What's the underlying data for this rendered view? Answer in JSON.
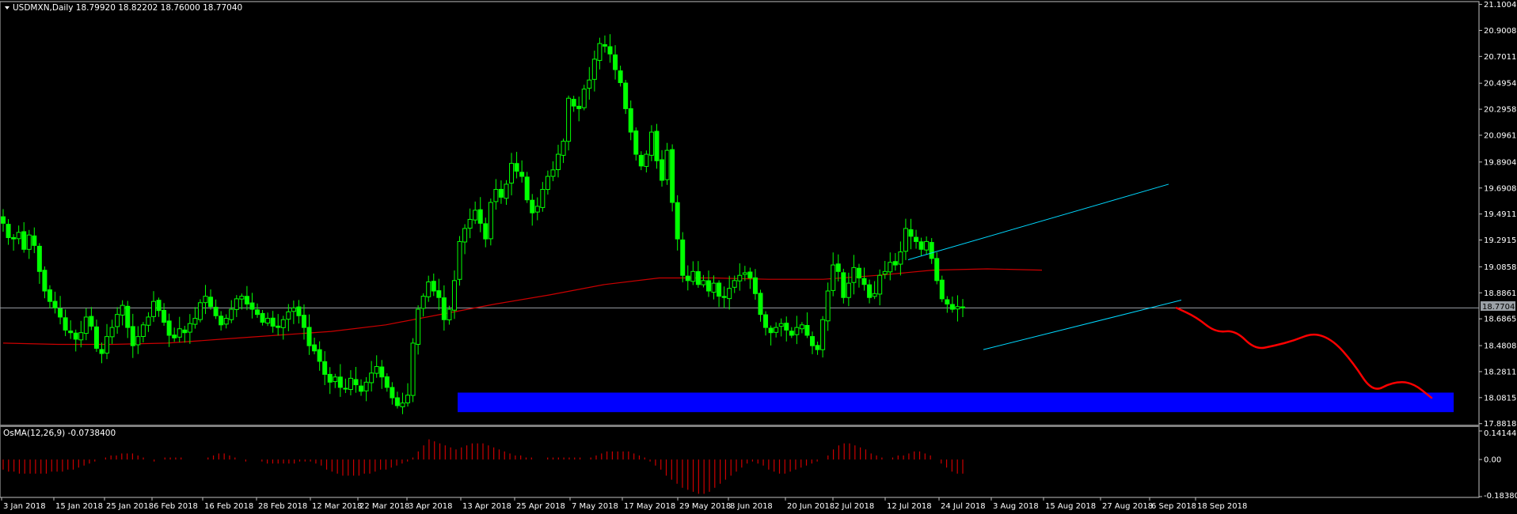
{
  "header": {
    "title": "USDMXN,Daily  18.79920 18.82202 18.76000 18.77040",
    "osma_title": "OsMA(12,26,9) -0.0738400"
  },
  "colors": {
    "background": "#000000",
    "frame": "#c0c0c0",
    "candle": "#00ff00",
    "ma": "#cc0000",
    "channel": "#00d8ff",
    "forecast": "#ff0000",
    "zone": "#0000ff",
    "osma": "#cc0000",
    "current_price_line": "#9aa0a6"
  },
  "chart_data": [
    {
      "type": "candlestick",
      "title": "USDMXN,Daily",
      "ohlc_current": {
        "open": 18.7992,
        "high": 18.82202,
        "low": 18.76,
        "close": 18.7704
      },
      "x_ticks": [
        "3 Jan 2018",
        "15 Jan 2018",
        "25 Jan 2018",
        "6 Feb 2018",
        "16 Feb 2018",
        "28 Feb 2018",
        "12 Mar 2018",
        "22 Mar 2018",
        "3 Apr 2018",
        "13 Apr 2018",
        "25 Apr 2018",
        "7 May 2018",
        "17 May 2018",
        "29 May 2018",
        "8 Jun 2018",
        "20 Jun 2018",
        "2 Jul 2018",
        "12 Jul 2018",
        "24 Jul 2018",
        "3 Aug 2018",
        "15 Aug 2018",
        "27 Aug 2018",
        "6 Sep 2018",
        "18 Sep 2018"
      ],
      "y_ticks": [
        "21.10045",
        "20.90080",
        "20.70115",
        "20.49545",
        "20.29580",
        "20.09615",
        "19.89045",
        "19.69080",
        "19.49115",
        "19.29150",
        "19.08580",
        "18.88615",
        "18.68650",
        "18.48080",
        "18.28115",
        "18.08150",
        "17.88185"
      ],
      "ylim": [
        17.88,
        21.11
      ],
      "current_price": "18.77040",
      "closes": [
        19.42,
        19.31,
        19.3,
        19.35,
        19.22,
        19.33,
        19.25,
        19.05,
        18.9,
        18.82,
        18.77,
        18.7,
        18.6,
        18.58,
        18.53,
        18.58,
        18.7,
        18.63,
        18.46,
        18.42,
        18.55,
        18.62,
        18.72,
        18.79,
        18.62,
        18.48,
        18.55,
        18.64,
        18.7,
        18.82,
        18.75,
        18.66,
        18.56,
        18.54,
        18.61,
        18.58,
        18.65,
        18.69,
        18.81,
        18.86,
        18.78,
        18.71,
        18.64,
        18.69,
        18.76,
        18.84,
        18.86,
        18.8,
        18.76,
        18.72,
        18.66,
        18.69,
        18.63,
        18.62,
        18.68,
        18.74,
        18.77,
        18.71,
        18.62,
        18.48,
        18.44,
        18.36,
        18.26,
        18.2,
        18.24,
        18.16,
        18.15,
        18.23,
        18.18,
        18.13,
        18.2,
        18.27,
        18.32,
        18.24,
        18.16,
        18.08,
        18.02,
        18.04,
        18.1,
        18.5,
        18.76,
        18.86,
        18.97,
        18.9,
        18.85,
        18.68,
        18.76,
        18.98,
        19.28,
        19.38,
        19.45,
        19.52,
        19.42,
        19.3,
        19.58,
        19.68,
        19.62,
        19.72,
        19.88,
        19.82,
        19.78,
        19.6,
        19.5,
        19.55,
        19.68,
        19.78,
        19.83,
        19.95,
        20.05,
        20.38,
        20.32,
        20.3,
        20.45,
        20.52,
        20.68,
        20.8,
        20.78,
        20.72,
        20.6,
        20.5,
        20.3,
        20.12,
        19.95,
        19.86,
        19.95,
        20.12,
        19.9,
        19.75,
        19.98,
        19.58,
        19.3,
        19.02,
        18.98,
        19.05,
        18.95,
        18.98,
        18.9,
        18.96,
        18.86,
        18.85,
        18.92,
        18.98,
        19.02,
        19.04,
        19.0,
        18.88,
        18.72,
        18.62,
        18.58,
        18.62,
        18.65,
        18.6,
        18.56,
        18.62,
        18.64,
        18.56,
        18.48,
        18.45,
        18.68,
        18.9,
        19.1,
        19.05,
        18.85,
        18.96,
        19.08,
        19.0,
        18.95,
        18.85,
        18.88,
        19.02,
        19.05,
        19.12,
        19.1,
        19.2,
        19.38,
        19.32,
        19.28,
        19.22,
        19.28,
        19.15,
        18.98,
        18.84,
        18.8,
        18.76,
        18.78,
        18.77
      ],
      "series": [
        {
          "name": "MA",
          "values": [
            18.5,
            18.49,
            18.49,
            18.5,
            18.53,
            18.56,
            18.59,
            18.64,
            18.72,
            18.8,
            18.87,
            18.95,
            19.0,
            19.0,
            18.99,
            18.99,
            19.02,
            19.06,
            19.07,
            19.06
          ]
        }
      ],
      "forecast": [
        18.77,
        18.7,
        18.58,
        18.6,
        18.45,
        18.48,
        18.52,
        18.58,
        18.52,
        18.35,
        18.12,
        18.2,
        18.2,
        18.08
      ],
      "channel": {
        "upper": {
          "from": [
            "12 Jul 2018",
            19.14
          ],
          "to": [
            "18 Sep 2018",
            19.72
          ]
        },
        "lower": {
          "from": [
            "3 Aug 2018",
            18.45
          ],
          "to": [
            "18 Sep 2018",
            18.83
          ]
        }
      },
      "zone": {
        "from": "13 Apr 2018",
        "y": [
          17.97,
          18.12
        ]
      }
    },
    {
      "type": "bar",
      "title": "OsMA(12,26,9) -0.0738400",
      "y_ticks": [
        "0.1414461",
        "0.00",
        "-0.1838005"
      ],
      "ylim": [
        -0.1838005,
        0.1414461
      ],
      "values": [
        -0.05,
        -0.06,
        -0.06,
        -0.07,
        -0.07,
        -0.07,
        -0.07,
        -0.07,
        -0.07,
        -0.06,
        -0.06,
        -0.06,
        -0.05,
        -0.05,
        -0.04,
        -0.03,
        -0.02,
        -0.01,
        0.0,
        0.01,
        0.02,
        0.02,
        0.03,
        0.03,
        0.03,
        0.02,
        0.01,
        0.0,
        -0.01,
        0.0,
        0.01,
        0.01,
        0.01,
        0.01,
        0.0,
        0.0,
        0.0,
        0.0,
        0.01,
        0.02,
        0.03,
        0.03,
        0.02,
        0.01,
        0.0,
        -0.01,
        0.0,
        0.0,
        -0.01,
        -0.02,
        -0.02,
        -0.02,
        -0.02,
        -0.02,
        -0.02,
        -0.01,
        -0.01,
        -0.01,
        -0.02,
        -0.03,
        -0.05,
        -0.06,
        -0.07,
        -0.08,
        -0.08,
        -0.08,
        -0.08,
        -0.07,
        -0.07,
        -0.06,
        -0.05,
        -0.05,
        -0.04,
        -0.03,
        -0.02,
        -0.01,
        0.01,
        0.04,
        0.07,
        0.1,
        0.09,
        0.08,
        0.07,
        0.06,
        0.05,
        0.06,
        0.07,
        0.08,
        0.08,
        0.08,
        0.07,
        0.06,
        0.05,
        0.04,
        0.03,
        0.02,
        0.02,
        0.01,
        0.01,
        0.0,
        0.0,
        0.01,
        0.01,
        0.01,
        0.01,
        0.01,
        0.01,
        0.01,
        0.0,
        0.01,
        0.02,
        0.03,
        0.04,
        0.04,
        0.04,
        0.04,
        0.04,
        0.03,
        0.02,
        0.01,
        -0.01,
        -0.03,
        -0.05,
        -0.08,
        -0.1,
        -0.12,
        -0.14,
        -0.15,
        -0.16,
        -0.17,
        -0.17,
        -0.16,
        -0.14,
        -0.12,
        -0.1,
        -0.08,
        -0.06,
        -0.04,
        -0.02,
        -0.01,
        -0.02,
        -0.03,
        -0.05,
        -0.06,
        -0.07,
        -0.07,
        -0.06,
        -0.05,
        -0.04,
        -0.03,
        -0.02,
        -0.01,
        0.0,
        0.02,
        0.05,
        0.07,
        0.08,
        0.08,
        0.07,
        0.06,
        0.05,
        0.03,
        0.02,
        0.01,
        0.0,
        0.01,
        0.02,
        0.02,
        0.03,
        0.04,
        0.04,
        0.03,
        0.02,
        0.0,
        -0.02,
        -0.04,
        -0.06,
        -0.07,
        -0.07
      ]
    }
  ]
}
